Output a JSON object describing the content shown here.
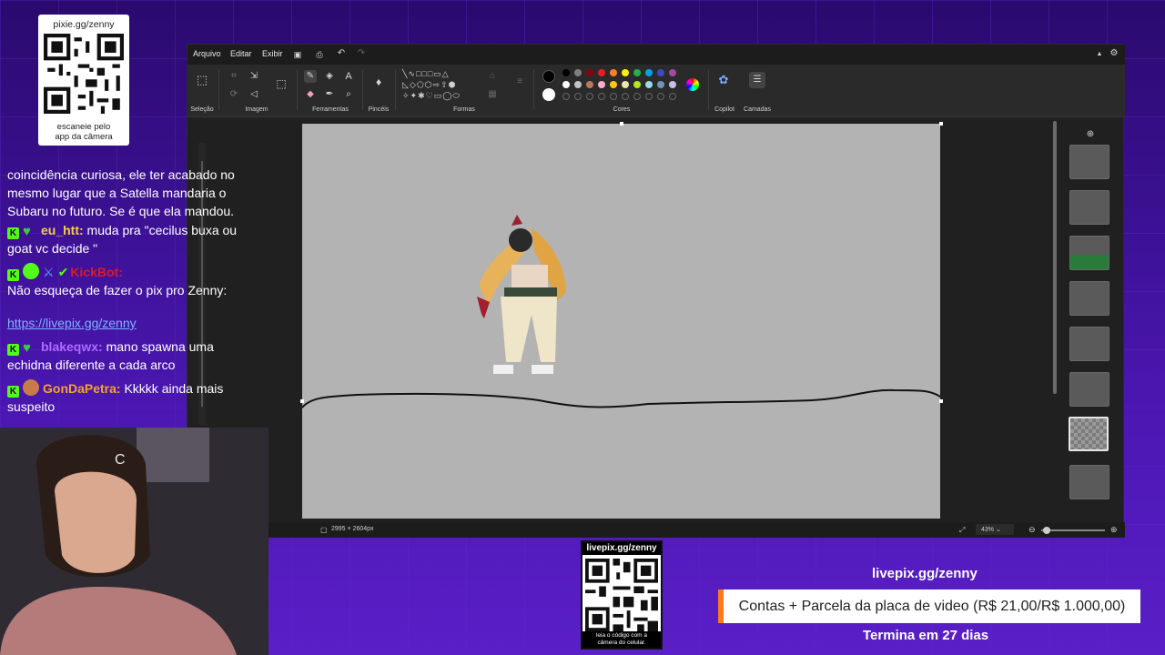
{
  "qr_card": {
    "title": "pixie.gg/zenny",
    "caption_line1": "escaneie pelo",
    "caption_line2": "app da câmera"
  },
  "paint": {
    "menu": [
      "Arquivo",
      "Editar",
      "Exibir"
    ],
    "groups": {
      "selection": "Seleção",
      "image": "Imagem",
      "tools": "Ferramentas",
      "brushes": "Pincéis",
      "shapes": "Formas",
      "colors": "Cores",
      "copilot": "Copilot",
      "layers": "Camadas"
    },
    "status": {
      "canvas_size": "2995 × 2604px",
      "zoom": "43%"
    },
    "palette": {
      "primary": "#000000",
      "secondary": "#ffffff",
      "row1": [
        "#000000",
        "#7f7f7f",
        "#880015",
        "#ed1c24",
        "#ff7f27",
        "#fff200",
        "#22b14c",
        "#00a2e8",
        "#3f48cc",
        "#a349a4"
      ],
      "row2": [
        "#ffffff",
        "#c3c3c3",
        "#b97a57",
        "#ffaec9",
        "#ffc90e",
        "#efe4b0",
        "#b5e61d",
        "#99d9ea",
        "#7092be",
        "#c8bfe7"
      ]
    }
  },
  "chat": {
    "line1": "coincidência curiosa, ele ter acabado no",
    "line2": "mesmo lugar que a Satella mandaria o",
    "line3": "Subaru no futuro. Se é que ela mandou.",
    "msg1_user": "eu_htt:",
    "msg1_text_a": " muda pra \"cecilus buxa ou",
    "msg1_text_b": "goat vc decide \"",
    "msg2_user": "KickBot:",
    "msg2_text": "Não esqueça de fazer o pix pro Zenny:",
    "msg2_link": "https://livepix.gg/zenny",
    "msg3_user": "blakeqwx:",
    "msg3_text_a": " mano spawna uma",
    "msg3_text_b": "echidna diferente a cada arco",
    "msg4_user": "GonDaPetra:",
    "msg4_text_a": " Kkkkk ainda mais",
    "msg4_text_b": "suspeito"
  },
  "qr_bottom": {
    "header": "livepix.gg/zenny",
    "footer_line1": "leia o código com a",
    "footer_line2": "câmera do celular."
  },
  "goal": {
    "url": "livepix.gg/zenny",
    "label": "Contas + Parcela da placa de video (R$ 21,00/R$ 1.000,00)",
    "ends": "Termina em 27 dias"
  },
  "icons": [
    "qr-code-icon",
    "save-icon",
    "undo-icon",
    "redo-icon",
    "settings-icon",
    "add-layer-icon",
    "copilot-icon",
    "layers-icon",
    "zoom-out-icon",
    "zoom-in-icon",
    "fit-icon"
  ]
}
